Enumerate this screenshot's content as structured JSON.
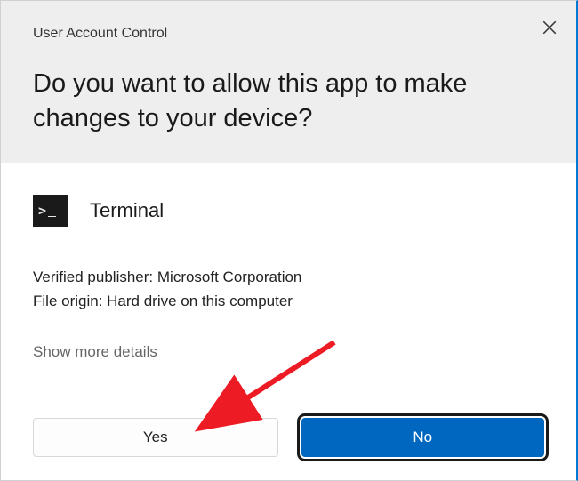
{
  "header": {
    "title_small": "User Account Control",
    "title_large": "Do you want to allow this app to make changes to your device?"
  },
  "app": {
    "name": "Terminal",
    "icon_name": "terminal-icon"
  },
  "details": {
    "publisher_label": "Verified publisher: ",
    "publisher_value": "Microsoft Corporation",
    "origin_label": "File origin: ",
    "origin_value": "Hard drive on this computer"
  },
  "show_more_label": "Show more details",
  "buttons": {
    "yes_label": "Yes",
    "no_label": "No"
  },
  "annotation": {
    "arrow_color": "#ed1c24"
  }
}
